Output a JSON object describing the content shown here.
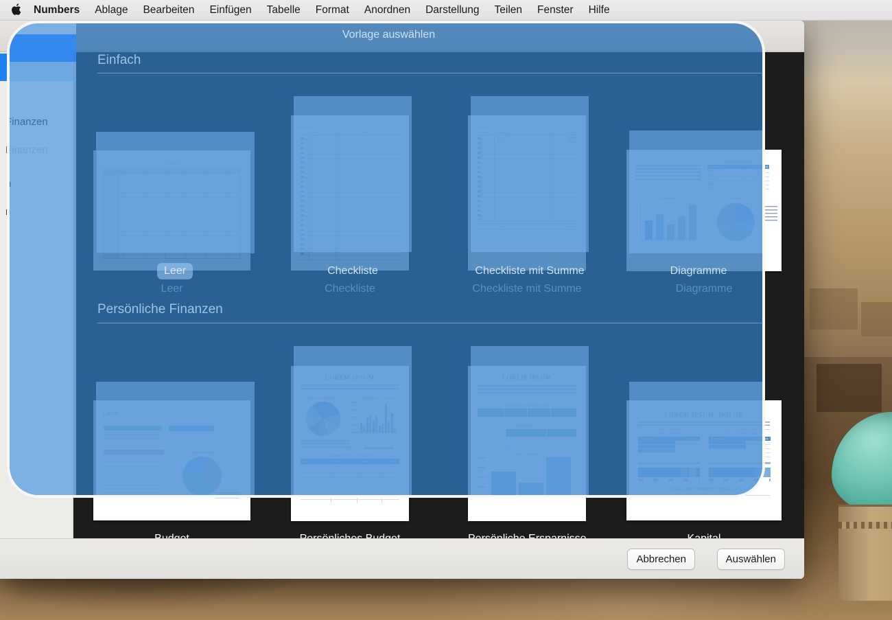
{
  "menubar": {
    "apple_icon": "apple-logo-icon",
    "items": [
      {
        "label": "Numbers",
        "bold": true
      },
      {
        "label": "Ablage"
      },
      {
        "label": "Bearbeiten"
      },
      {
        "label": "Einfügen"
      },
      {
        "label": "Tabelle"
      },
      {
        "label": "Format"
      },
      {
        "label": "Anordnen"
      },
      {
        "label": "Darstellung"
      },
      {
        "label": "Teilen"
      },
      {
        "label": "Fenster"
      },
      {
        "label": "Hilfe"
      }
    ]
  },
  "dialog": {
    "overlay_title": "Vorlage auswählen",
    "accent_color": "#2e72b3",
    "border_color": "#ffffff",
    "sidebar": {
      "selected_index": 0,
      "visible_items": [
        {
          "label": "Finanzen"
        },
        {
          "label": "n"
        }
      ]
    },
    "sections": [
      {
        "title": "Einfach",
        "templates": [
          {
            "label": "Leer",
            "selected": true
          },
          {
            "label": "Checkliste",
            "selected": false
          },
          {
            "label": "Checkliste mit Summe",
            "selected": false
          },
          {
            "label": "Diagramme",
            "selected": false
          }
        ]
      },
      {
        "title": "Persönliche Finanzen",
        "templates": [
          {
            "label": "Budget",
            "selected": false
          },
          {
            "label": "Persönliches Budget",
            "selected": false
          },
          {
            "label": "Persönliche Ersparnisse",
            "selected": false
          },
          {
            "label": "Kapital",
            "selected": false
          }
        ]
      }
    ],
    "buttons": {
      "cancel": "Abbrechen",
      "choose": "Auswählen"
    }
  },
  "thumbnails": {
    "blank": {
      "table_title": "Table 1",
      "columns": 7,
      "rows": 18
    },
    "checklist": {
      "heading": "CHECKLIST",
      "columns": [
        "Status",
        "Task"
      ],
      "rows": 25
    },
    "checklist_sum": {
      "heading": "CHECKLIST",
      "columns": [
        "Checkbox",
        "Description",
        "Amount"
      ],
      "rows": [
        {
          "description": "Item 1",
          "amount": "$ 50.00"
        },
        {
          "description": "Item 2",
          "amount": "$100.00"
        }
      ],
      "total_label": "Total",
      "total_value": "$150.00"
    },
    "charts": {
      "body_text": "Column, bar, and pie charts compare values in a single category, such as the number of products sold by each salesperson. Pie charts show each category's value as a percentage of the whole.",
      "table_title": "Furniture Sales by Salesperson",
      "table_columns": [
        "SALESPERSON",
        "UNITS SOLD"
      ],
      "table_rows": [
        {
          "name": "Kelly",
          "units": 10
        },
        {
          "name": "Chris",
          "units": 13
        },
        {
          "name": "Daniel",
          "units": 8
        },
        {
          "name": "Naoko",
          "units": 12
        },
        {
          "name": "Sophia",
          "units": 17
        }
      ],
      "column_chart_title": "Column Chart",
      "pie_chart_title": "Pie Chart",
      "legend": [
        "Kelly",
        "Chris",
        "Daniel",
        "Naoko",
        "Sophia"
      ]
    },
    "budget": {
      "title": "Lorem",
      "table1_header": "MONEY IN",
      "table1_rows": [
        {
          "label": "Paycheck",
          "value": "$4,500"
        },
        {
          "label": "Additional income",
          "value": "$0"
        }
      ],
      "table1_total": {
        "label": "TOTAL INCOME",
        "value": "$4,500"
      },
      "table2_header": "MONEY LEFT OVER",
      "table2_rows": [
        {
          "label": "Income minus expenses",
          "value": "$1,075"
        }
      ],
      "table3_header": "MONEY OUT",
      "table3_rows": [
        {
          "label": "Housing (Rent, mortgage, taxes, insurance)",
          "value": "$1,500"
        },
        {
          "label": "Transportation",
          "value": "$300"
        },
        {
          "label": "Utilities",
          "value": "$200"
        },
        {
          "label": "Insurance",
          "value": "$300"
        },
        {
          "label": "Medical",
          "value": "$50"
        },
        {
          "label": "Dining, travel, entertainment",
          "value": "$150"
        },
        {
          "label": "Debt payments",
          "value": "$50"
        },
        {
          "label": "Savings",
          "value": "$0"
        },
        {
          "label": "Education",
          "value": "$150"
        },
        {
          "label": "Miscellaneous",
          "value": "$125"
        }
      ],
      "table3_total": {
        "label": "TOTAL EXPENSES",
        "value": "$3,425"
      },
      "chart_title": "Income/Expenses"
    },
    "personal_budget": {
      "title": "LOREM IPSUM",
      "body_text": "HOW TO USE: Enter your budget for each category in the Summary By Category table below. Enter transactions on the Transactions sheet to see how your actual spending compares to your budget.",
      "pie_title": "ACTUAL SUMMARY",
      "bar_title": "BUDGET VS. ACTUAL",
      "table_title": "SUMMARY BY CATEGORY",
      "table_columns": [
        "Category",
        "Budget",
        "Actual",
        "Difference"
      ],
      "table_rows": [
        "Auto",
        "Entertainment",
        "Food",
        "Home",
        "Medical",
        "Personal Items",
        "Travel",
        "Utilities"
      ],
      "legend": [
        "Auto",
        "Entertainment",
        "Food",
        "Home",
        "Medical",
        "Personal Items",
        "Travel",
        "Utilities",
        "Other"
      ],
      "bar_legend": [
        "Budget",
        "Actual"
      ],
      "y_ticks": [
        "$0.00",
        "$125.00",
        "$250.00",
        "$375.00",
        "$500.00"
      ]
    },
    "personal_savings": {
      "title": "LOREM IPSUM",
      "body_text": "HOW TO USE: This sheet calculates how much to save each month to reach your savings goal or the number of years you need to save. Enter your information on the Savings Calculator table in the Results table.",
      "section1": "SAVINGS CALCULATOR",
      "section1_columns": [
        "Current amount you have saved",
        "Number of years you can save",
        "Annual Percentage Yield (APY)",
        "Amount you want to save"
      ],
      "section2": "RESULTS",
      "section2_columns": [
        "",
        "Total amount you will save",
        "Amount you need to contribute each month"
      ],
      "section2_rows": [
        "Your goal",
        "Current interest rate",
        "No interest earned"
      ],
      "chart_title": "TOTAL SAVED",
      "y_ticks": [
        "$0",
        "$5,000",
        "$10,000",
        "$15,000",
        "$20,000"
      ],
      "bar_values": [
        9500,
        5250,
        17000
      ]
    },
    "capital": {
      "title": "LOREM IPSUM: DOLOR",
      "body_text": "HOW TO USE: This sheet shows a summary of net worth based on calculations of total assets and total liabilities. To customize the data, edit the categories on the Assets sheet and the Liabilities sheet. As you edit those sheets, this sheet automatically updates.",
      "left_title": "TOTAL ASSETS",
      "left_columns": [
        "Asset Category",
        "Asset Value"
      ],
      "left_rows": [
        {
          "label": "Cash and Financial Assets",
          "value": "$247,125"
        },
        {
          "label": "Capital Assets",
          "value": "$84,515"
        },
        {
          "label": "Personal Assets",
          "value": "$21,775"
        }
      ],
      "left_total": {
        "label": "Total assets",
        "value": "$353,415"
      },
      "right_title": "TOTAL LIABILITIES",
      "right_columns": [
        "Debt Category",
        "Liability Value"
      ],
      "right_rows": [
        {
          "label": "Long-Term Liabilities",
          "value": "$24,100"
        },
        {
          "label": "Short-Term Liabilities",
          "value": "$3,050"
        }
      ],
      "right_total": {
        "label": "Total liabilities",
        "value": "$27,150"
      },
      "net_worth_label": "TOTAL NET WORTH:",
      "net_worth_value": "$326,265",
      "x_ticks": [
        "$0",
        "$100,000",
        "$200,000",
        "$300,000",
        "$400,000"
      ]
    }
  }
}
